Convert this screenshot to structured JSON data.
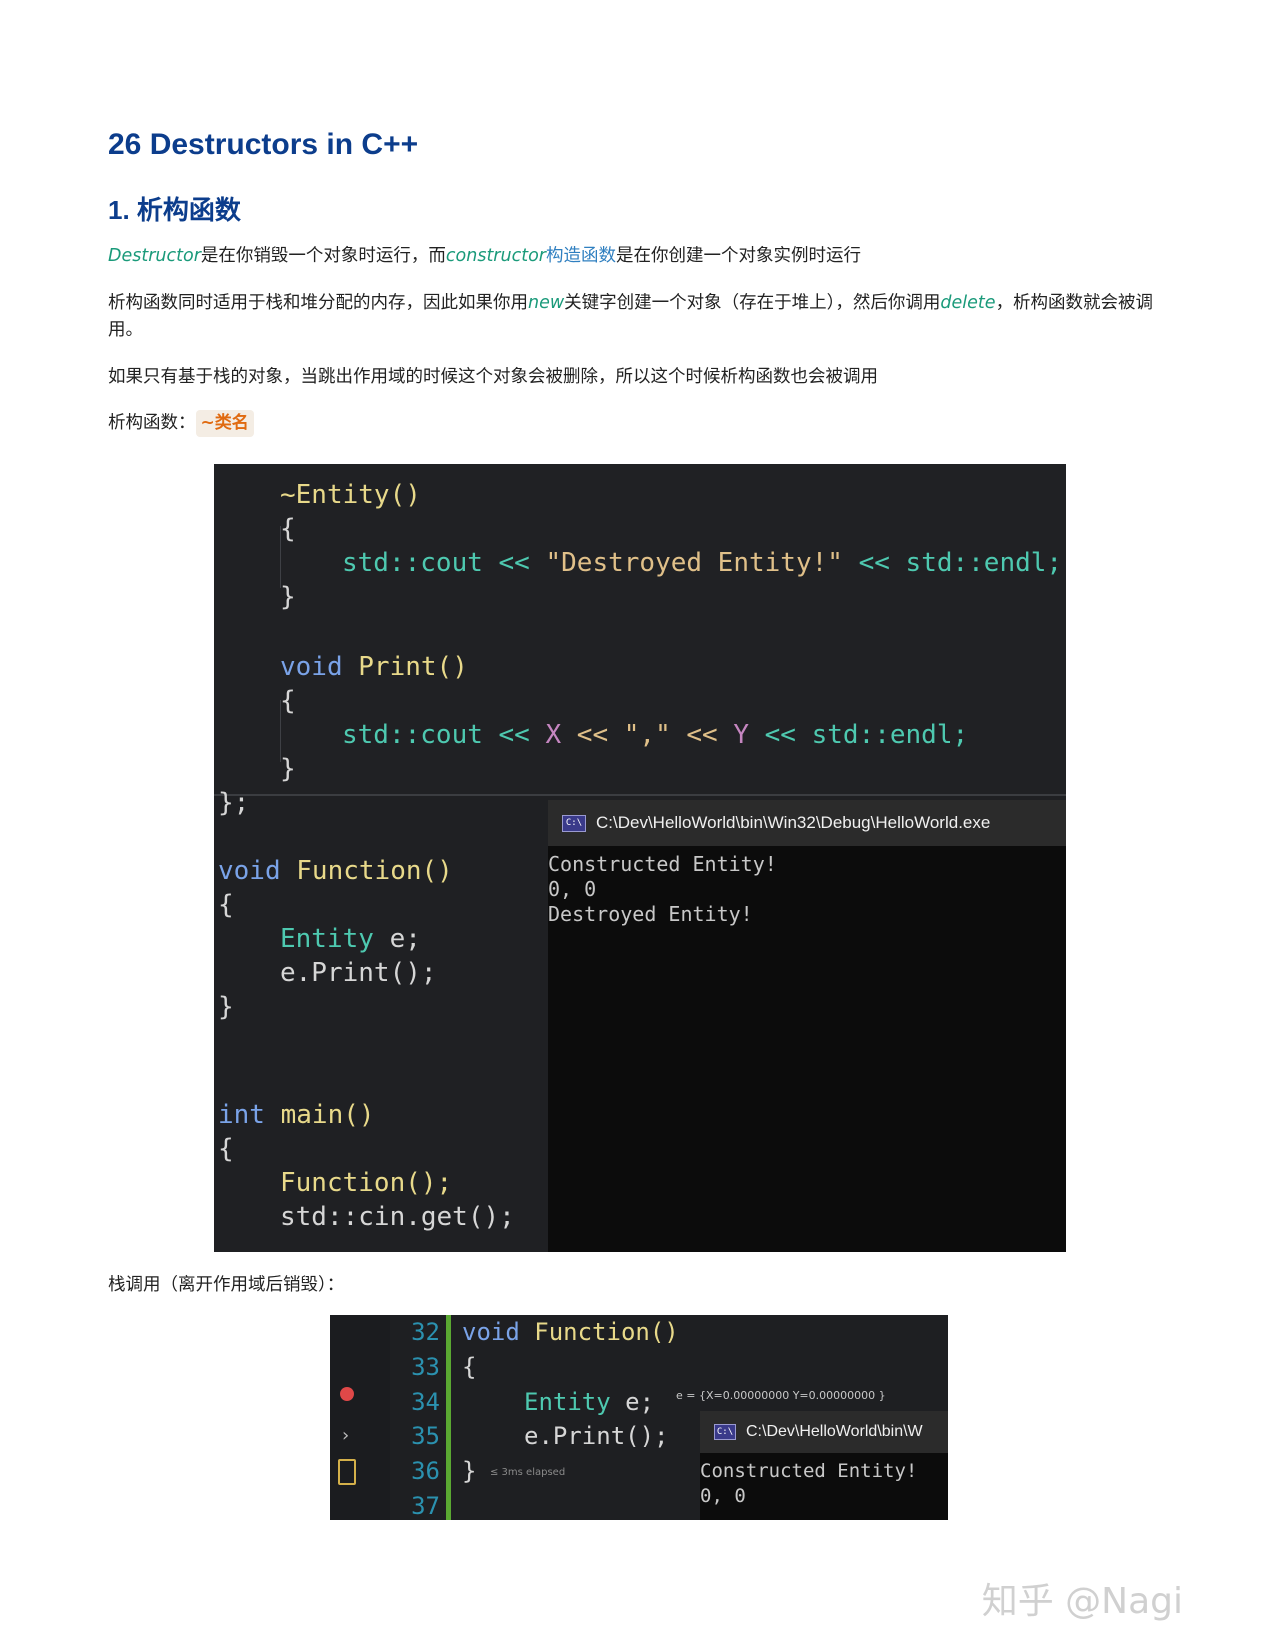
{
  "title": "26 Destructors in C++",
  "section_heading": "1. 析构函数",
  "p1": {
    "term1": "Destructor",
    "text1": "是在你销毁一个对象时运行，而",
    "term2": "constructor",
    "term2b": "构造函数",
    "text2": "是在你创建一个对象实例时运行"
  },
  "p2": {
    "text1": "析构函数同时适用于栈和堆分配的内存，因此如果你用",
    "kw_new": "new",
    "text2": "关键字创建一个对象（存在于堆上），然后你调用",
    "kw_delete": "delete",
    "text3": "，析构函数就会被调用。"
  },
  "p3": "如果只有基于栈的对象，当跳出作用域的时候这个对象会被删除，所以这个时候析构函数也会被调用",
  "p4": {
    "label": "析构函数：",
    "code": "~类名"
  },
  "shot1": {
    "line_destructor": "~Entity()",
    "brace_open": "{",
    "brace_close": "}",
    "cout": "std::cout << ",
    "destroyed_str": "\"Destroyed Entity!\"",
    "endl_tail": " << std::endl;",
    "void_kw": "void ",
    "print_fn": "Print()",
    "print_line_a": "std::cout << ",
    "x_var": "X",
    "print_line_b": " << \",\" << ",
    "y_var": "Y",
    "print_line_c": " << std::endl;",
    "class_end": "};",
    "func_void": "void ",
    "func_name": "Function()",
    "entity_type": "Entity",
    "entity_decl": " e;",
    "e_print": "e.Print();",
    "int_kw": "int ",
    "main_fn": "main()",
    "call_function": "Function();",
    "cin_get": "std::cin.get();",
    "console": {
      "icon": "C:\\",
      "title": "C:\\Dev\\HelloWorld\\bin\\Win32\\Debug\\HelloWorld.exe",
      "output": [
        "Constructed Entity!",
        "0, 0",
        "Destroyed Entity!"
      ]
    }
  },
  "caption2": "栈调用（离开作用域后销毁）：",
  "shot2": {
    "line_numbers": [
      "32",
      "33",
      "34",
      "35",
      "36",
      "37"
    ],
    "func_void": "void ",
    "func_name": "Function()",
    "brace_open": "{",
    "entity_type": "Entity",
    "entity_decl": " e;",
    "datatip": "e = {X=0.00000000 Y=0.00000000 }",
    "e_print": "e.Print();",
    "brace_close": "}",
    "elapsed": "≤ 3ms elapsed",
    "console": {
      "icon": "C:\\",
      "title": "C:\\Dev\\HelloWorld\\bin\\W",
      "output": [
        "Constructed Entity!",
        "0, 0"
      ]
    }
  },
  "watermark": "知乎 @Nagi"
}
